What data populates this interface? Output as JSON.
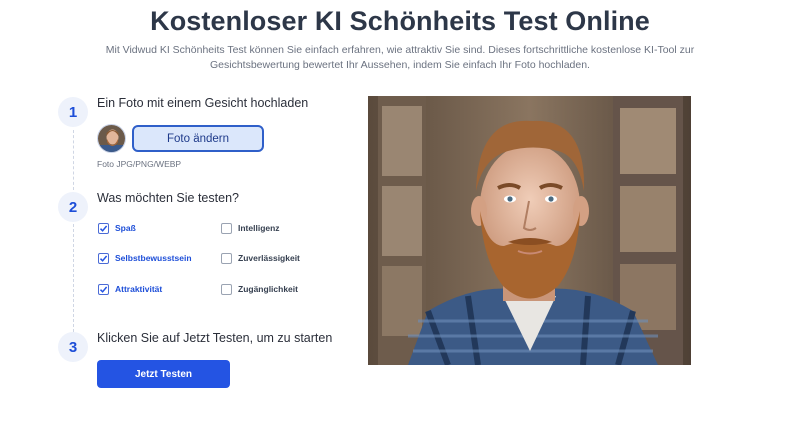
{
  "header": {
    "title": "Kostenloser KI Schönheits Test Online",
    "subtitle": "Mit Vidwud KI Schönheits Test können Sie einfach erfahren, wie attraktiv Sie sind. Dieses fortschrittliche kostenlose KI-Tool zur Gesichtsbewertung bewertet Ihr Aussehen, indem Sie einfach Ihr Foto hochladen."
  },
  "steps": [
    {
      "number": "1",
      "title": "Ein Foto mit einem Gesicht hochladen"
    },
    {
      "number": "2",
      "title": "Was möchten Sie testen?"
    },
    {
      "number": "3",
      "title": "Klicken Sie auf Jetzt Testen, um zu starten"
    }
  ],
  "upload": {
    "change_photo_label": "Foto ändern",
    "formats_hint": "Foto JPG/PNG/WEBP"
  },
  "options": [
    {
      "label": "Spaß",
      "checked": true
    },
    {
      "label": "Intelligenz",
      "checked": false
    },
    {
      "label": "Selbstbewusstsein",
      "checked": true
    },
    {
      "label": "Zuverlässigkeit",
      "checked": false
    },
    {
      "label": "Attraktivität",
      "checked": true
    },
    {
      "label": "Zugänglichkeit",
      "checked": false
    }
  ],
  "actions": {
    "test_label": "Jetzt Testen"
  },
  "colors": {
    "accent": "#2454e3",
    "title": "#2d3748"
  }
}
